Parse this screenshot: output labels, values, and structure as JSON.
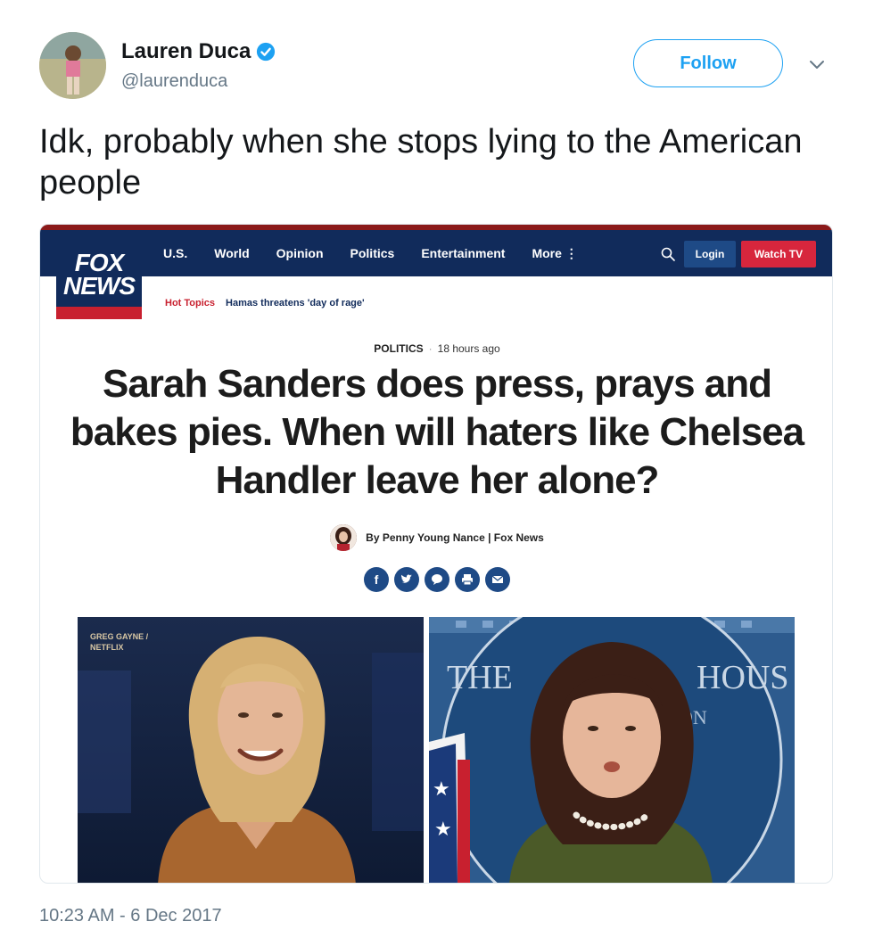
{
  "tweet": {
    "author_name": "Lauren Duca",
    "author_handle": "@laurenduca",
    "follow_label": "Follow",
    "text": "Idk, probably when she stops lying to the American people",
    "timestamp": "10:23 AM - 6 Dec 2017",
    "colors": {
      "accent": "#1da1f2",
      "secondary_text": "#657786"
    },
    "icons": [
      "verified-badge-icon",
      "chevron-down-icon"
    ]
  },
  "article": {
    "logo_line1": "FOX",
    "logo_line2": "NEWS",
    "nav": [
      "U.S.",
      "World",
      "Opinion",
      "Politics",
      "Entertainment",
      "More ⋮"
    ],
    "login_label": "Login",
    "watch_label": "Watch TV",
    "hot_topics_label": "Hot Topics",
    "hot_topic_link": "Hamas threatens 'day of rage'",
    "category": "POLITICS",
    "time_ago": "18 hours ago",
    "headline": "Sarah Sanders does press, prays and bakes pies. When will haters like Chelsea Handler leave her alone?",
    "byline": "By Penny Young Nance | Fox News",
    "share_icons": [
      "facebook-icon",
      "twitter-icon",
      "comment-icon",
      "print-icon",
      "email-icon"
    ],
    "photo_credit_line1": "GREG GAYNE /",
    "photo_credit_line2": "NETFLIX",
    "podium_text_left": "THE",
    "podium_text_right": "HOUS",
    "podium_text_sub": "ON",
    "colors": {
      "navy": "#112b5b",
      "red": "#c8202f",
      "watch_red": "#d7263d"
    }
  }
}
